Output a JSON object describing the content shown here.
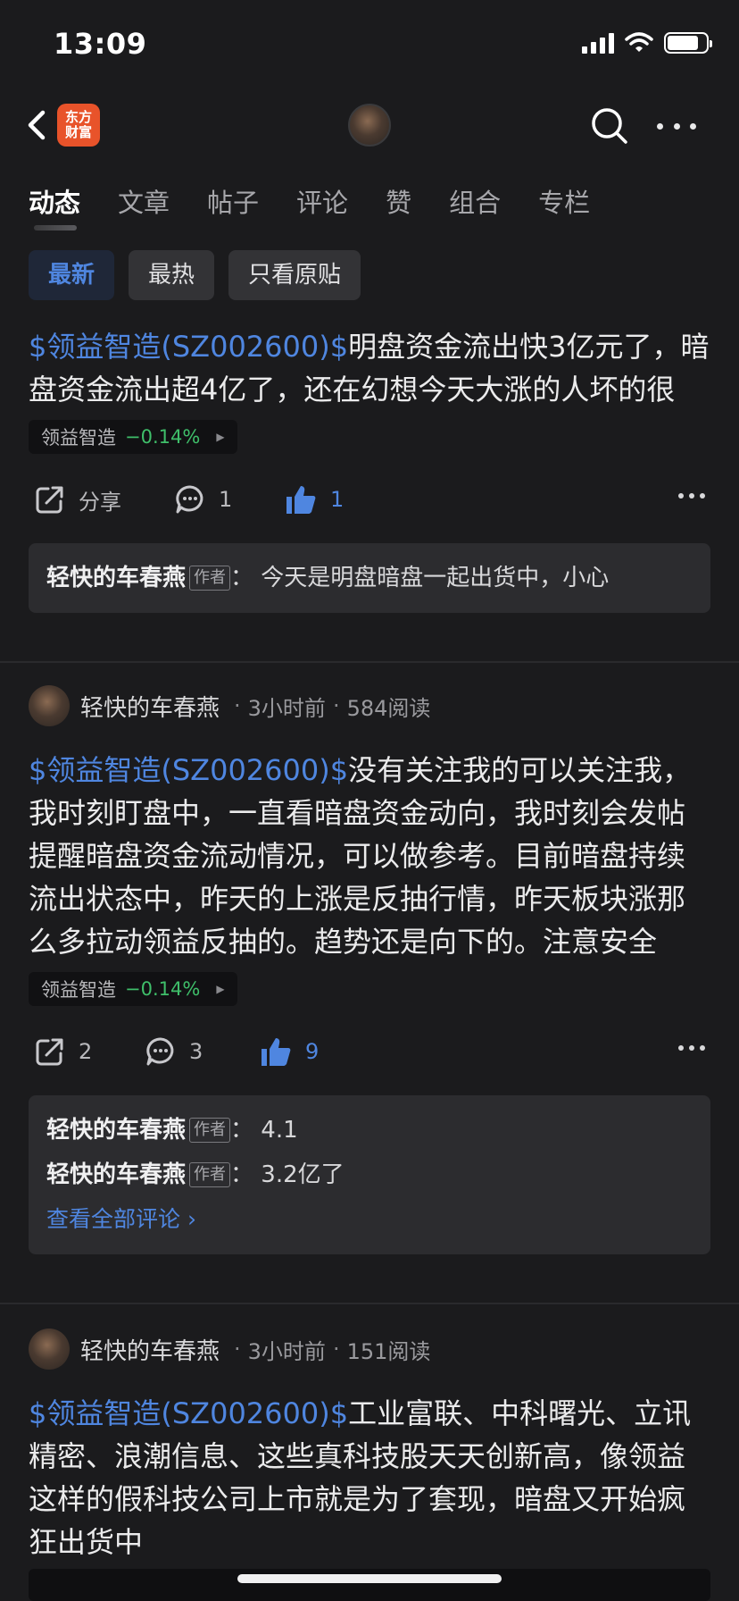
{
  "status_bar": {
    "time": "13:09"
  },
  "nav": {
    "logo_line1": "东方",
    "logo_line2": "财富"
  },
  "tabs": [
    {
      "label": "动态",
      "active": true
    },
    {
      "label": "文章",
      "active": false
    },
    {
      "label": "帖子",
      "active": false
    },
    {
      "label": "评论",
      "active": false
    },
    {
      "label": "赞",
      "active": false
    },
    {
      "label": "组合",
      "active": false
    },
    {
      "label": "专栏",
      "active": false
    }
  ],
  "filters": [
    {
      "label": "最新",
      "active": true
    },
    {
      "label": "最热",
      "active": false
    },
    {
      "label": "只看原贴",
      "active": false
    }
  ],
  "posts": [
    {
      "stock_link": "$领益智造(SZ002600)$",
      "text": "明盘资金流出快3亿元了，暗盘资金流出超4亿了，还在幻想今天大涨的人坏的很",
      "tag_name": "领益智造",
      "tag_change": "−0.14%",
      "share_label": "分享",
      "comment_count": "1",
      "like_count": "1",
      "comments": [
        {
          "author": "轻快的车春燕",
          "badge": "作者",
          "text": "：  今天是明盘暗盘一起出货中，小心"
        }
      ]
    },
    {
      "author": "轻快的车春燕",
      "time": "3小时前",
      "reads": "584阅读",
      "stock_link": "$领益智造(SZ002600)$",
      "text": "没有关注我的可以关注我，我时刻盯盘中，一直看暗盘资金动向，我时刻会发帖提醒暗盘资金流动情况，可以做参考。目前暗盘持续流出状态中，昨天的上涨是反抽行情，昨天板块涨那么多拉动领益反抽的。趋势还是向下的。注意安全",
      "tag_name": "领益智造",
      "tag_change": "−0.14%",
      "share_count": "2",
      "comment_count": "3",
      "like_count": "9",
      "comments": [
        {
          "author": "轻快的车春燕",
          "badge": "作者",
          "text": "：  4.1"
        },
        {
          "author": "轻快的车春燕",
          "badge": "作者",
          "text": "：  3.2亿了"
        }
      ],
      "view_all": "查看全部评论 ›"
    },
    {
      "author": "轻快的车春燕",
      "time": "3小时前",
      "reads": "151阅读",
      "stock_link": "$领益智造(SZ002600)$",
      "text": "工业富联、中科曙光、立讯精密、浪潮信息、这些真科技股天天创新高，像领益这样的假科技公司上市就是为了套现，暗盘又开始疯狂出货中"
    }
  ],
  "colors": {
    "accent": "#4f86e0",
    "up": "#3fbf6a",
    "background": "#1b1b1d"
  },
  "icons": [
    "back-icon",
    "search-icon",
    "more-icon",
    "share-icon",
    "comment-icon",
    "like-icon"
  ]
}
